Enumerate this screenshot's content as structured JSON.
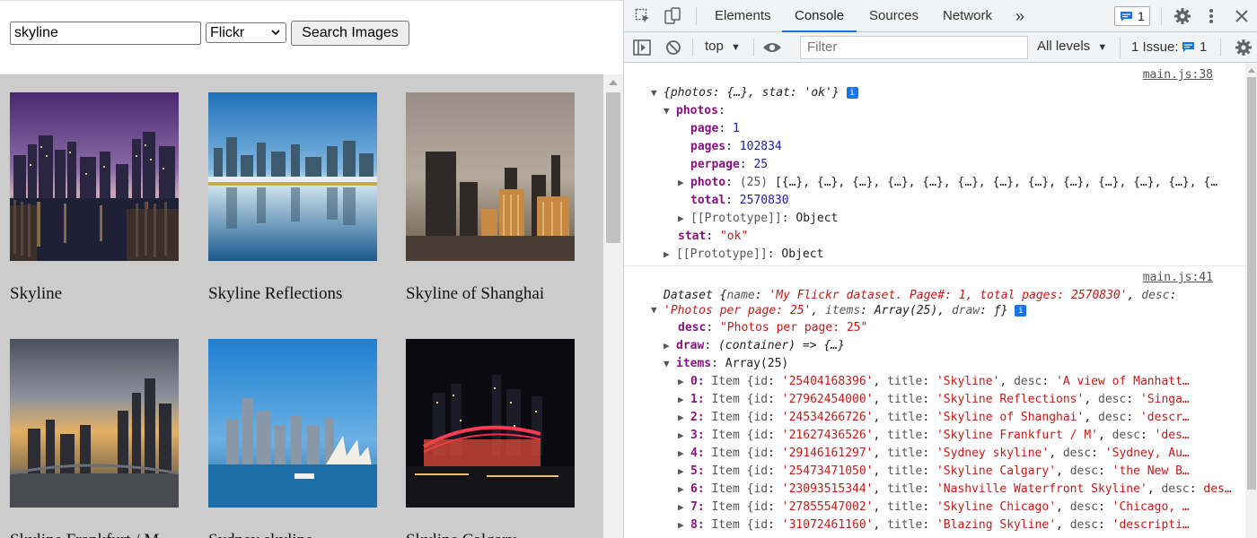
{
  "app": {
    "search_value": "skyline",
    "source_selected": "Flickr",
    "search_button_label": "Search Images",
    "results": [
      {
        "title": "Skyline",
        "image": "night city skyline with pier"
      },
      {
        "title": "Skyline Reflections",
        "image": "city skyline reflected in water"
      },
      {
        "title": "Skyline of Shanghai",
        "image": "shanghai towers at dusk"
      },
      {
        "title": "Skyline Frankfurt / M",
        "image": "frankfurt skyline stormy sky"
      },
      {
        "title": "Sydney skyline",
        "image": "sydney harbour and opera house"
      },
      {
        "title": "Skyline Calgary",
        "image": "calgary skyline at night"
      }
    ]
  },
  "devtools": {
    "tabs": [
      "Elements",
      "Console",
      "Sources",
      "Network"
    ],
    "active_tab": "Console",
    "more_tabs_glyph": "»",
    "message_count": "1",
    "context": "top",
    "filter_placeholder": "Filter",
    "levels": "All levels",
    "issues_label": "1 Issue:",
    "issues_count": "1",
    "log1": {
      "source": "main.js:38",
      "summary": "{photos: {…}, stat: 'ok'}",
      "photos_key": "photos",
      "page": "1",
      "pages": "102834",
      "perpage": "25",
      "photo_count": "(25)",
      "photo_preview": "[{…}, {…}, {…}, {…}, {…}, {…}, {…}, {…}, {…}, {…}, {…}, {…}, {…",
      "total": "2570830",
      "prototype": "Object",
      "stat": "\"ok\""
    },
    "log2": {
      "source": "main.js:41",
      "summary_name": "'My Flickr dataset. Page#: 1, total pages: 2570830'",
      "summary_desc": "'Photos per page: 25'",
      "summary_items": "Array(25)",
      "summary_draw": "ƒ",
      "desc": "\"Photos per page: 25\"",
      "draw": "(container) => {…}",
      "items": "Array(25)",
      "rows": [
        {
          "idx": "0",
          "id": "'25404168396'",
          "title": "'Skyline'",
          "desc": "'A view of Manhatt…"
        },
        {
          "idx": "1",
          "id": "'27962454000'",
          "title": "'Skyline Reflections'",
          "desc": "'Singa…"
        },
        {
          "idx": "2",
          "id": "'24534266726'",
          "title": "'Skyline of Shanghai'",
          "desc": "'descr…"
        },
        {
          "idx": "3",
          "id": "'21627436526'",
          "title": "'Skyline Frankfurt / M'",
          "desc": "'des…"
        },
        {
          "idx": "4",
          "id": "'29146161297'",
          "title": "'Sydney skyline'",
          "desc": "'Sydney, Au…"
        },
        {
          "idx": "5",
          "id": "'25473471050'",
          "title": "'Skyline Calgary'",
          "desc": "'the New B…"
        },
        {
          "idx": "6",
          "id": "'23093515344'",
          "title": "'Nashville Waterfront Skyline'",
          "desc": "des…"
        },
        {
          "idx": "7",
          "id": "'27855547002'",
          "title": "'Skyline Chicago'",
          "desc": "'Chicago, …"
        },
        {
          "idx": "8",
          "id": "'31072461160'",
          "title": "'Blazing Skyline'",
          "desc": "'descripti…"
        }
      ]
    }
  },
  "icons": {
    "inspect": "inspect-element-icon",
    "device": "device-toolbar-icon",
    "settings": "gear-icon",
    "more": "kebab-menu-icon",
    "close": "close-icon",
    "sidebar": "console-sidebar-icon",
    "clear": "clear-console-icon",
    "eye": "live-expression-icon",
    "message": "message-icon"
  },
  "colors": {
    "accent": "#1a73e8",
    "gallery_bg": "#cccccc",
    "string": "#c41a16",
    "number": "#1a1aa6",
    "key": "#881280"
  }
}
